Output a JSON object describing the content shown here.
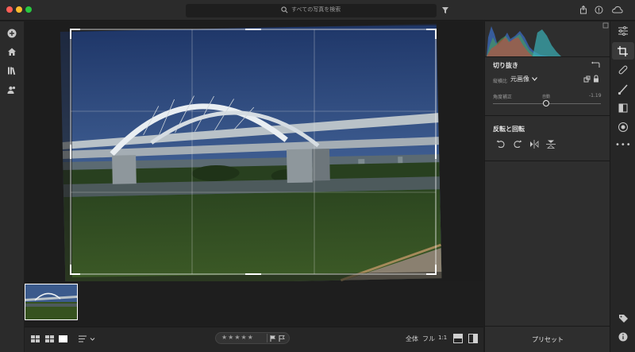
{
  "titlebar": {
    "search_placeholder": "すべての写真を検索",
    "icons": [
      "search-icon",
      "filter-icon",
      "share-icon",
      "info-icon",
      "cloud-sync-icon"
    ]
  },
  "leftbar": {
    "icons": [
      "add-icon",
      "home-icon",
      "library-icon",
      "people-icon"
    ]
  },
  "crop_panel": {
    "title": "切り抜き",
    "aspect_label": "縦横比",
    "aspect_value": "元画像",
    "angle_label": "角度補正",
    "auto_label": "自動",
    "angle_value": "-1.19"
  },
  "transform_panel": {
    "title": "反転と回転"
  },
  "presets_label": "プリセット",
  "bottom": {
    "view_all": "全体",
    "view_fill": "フル",
    "view_1to1": "1:1",
    "rating_stars": "★★★★★"
  },
  "colors": {
    "panel_bg": "#2e2e2e",
    "canvas_bg": "#1e1e1e",
    "accent": "#ffffff"
  }
}
